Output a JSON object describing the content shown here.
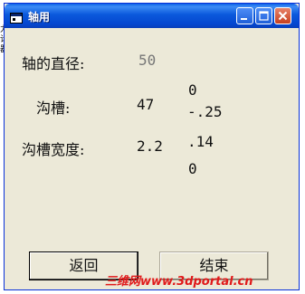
{
  "edge_fragment": "力\n计\n器",
  "window": {
    "title": "轴用"
  },
  "fields": {
    "shaft_diameter": {
      "label": "轴的直径:",
      "value": "50"
    },
    "groove": {
      "label": "沟槽:",
      "value": "47",
      "upper_dev": "0",
      "lower_dev": "-.25"
    },
    "groove_width": {
      "label": "沟槽宽度:",
      "value": "2.2",
      "upper_dev": ".14",
      "lower_dev": "0"
    }
  },
  "buttons": {
    "back_label": "返回",
    "end_label": "结束"
  },
  "watermark": "三维网www.3dportal.cn",
  "colors": {
    "titlebar": "#0a5fe6",
    "window_bg": "#ece9d8",
    "close_button": "#c6401f",
    "watermark": "#e0191a"
  },
  "icons": [
    "app-window-icon",
    "minimize-icon",
    "maximize-icon",
    "close-icon"
  ]
}
